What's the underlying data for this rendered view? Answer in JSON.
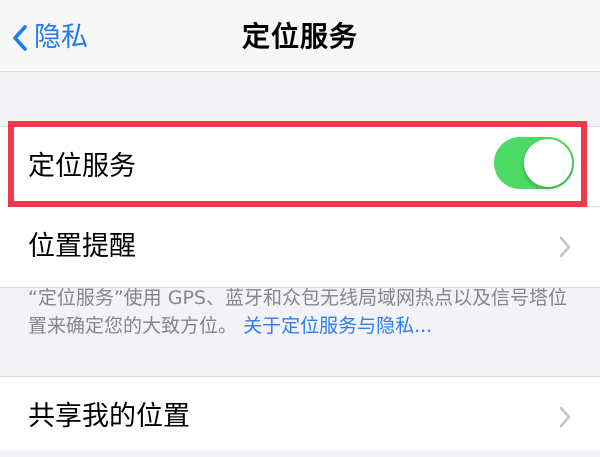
{
  "navbar": {
    "back_label": "隐私",
    "title": "定位服务"
  },
  "location_group": {
    "location_services": {
      "label": "定位服务",
      "toggle_on": true
    },
    "location_alerts": {
      "label": "位置提醒"
    }
  },
  "footer": {
    "description": "“定位服务”使用 GPS、蓝牙和众包无线局域网热点以及信号塔位置来确定您的大致方位。",
    "link": "关于定位服务与隐私..."
  },
  "share_group": {
    "share_location": {
      "label": "共享我的位置"
    }
  },
  "colors": {
    "accent_blue": "#1e7cf4",
    "toggle_green": "#4cd964",
    "highlight_red": "#f0394c",
    "background": "#f2f2f7"
  },
  "icons": {
    "back": "chevron-left-icon",
    "row_disclosure": "chevron-right-icon"
  }
}
